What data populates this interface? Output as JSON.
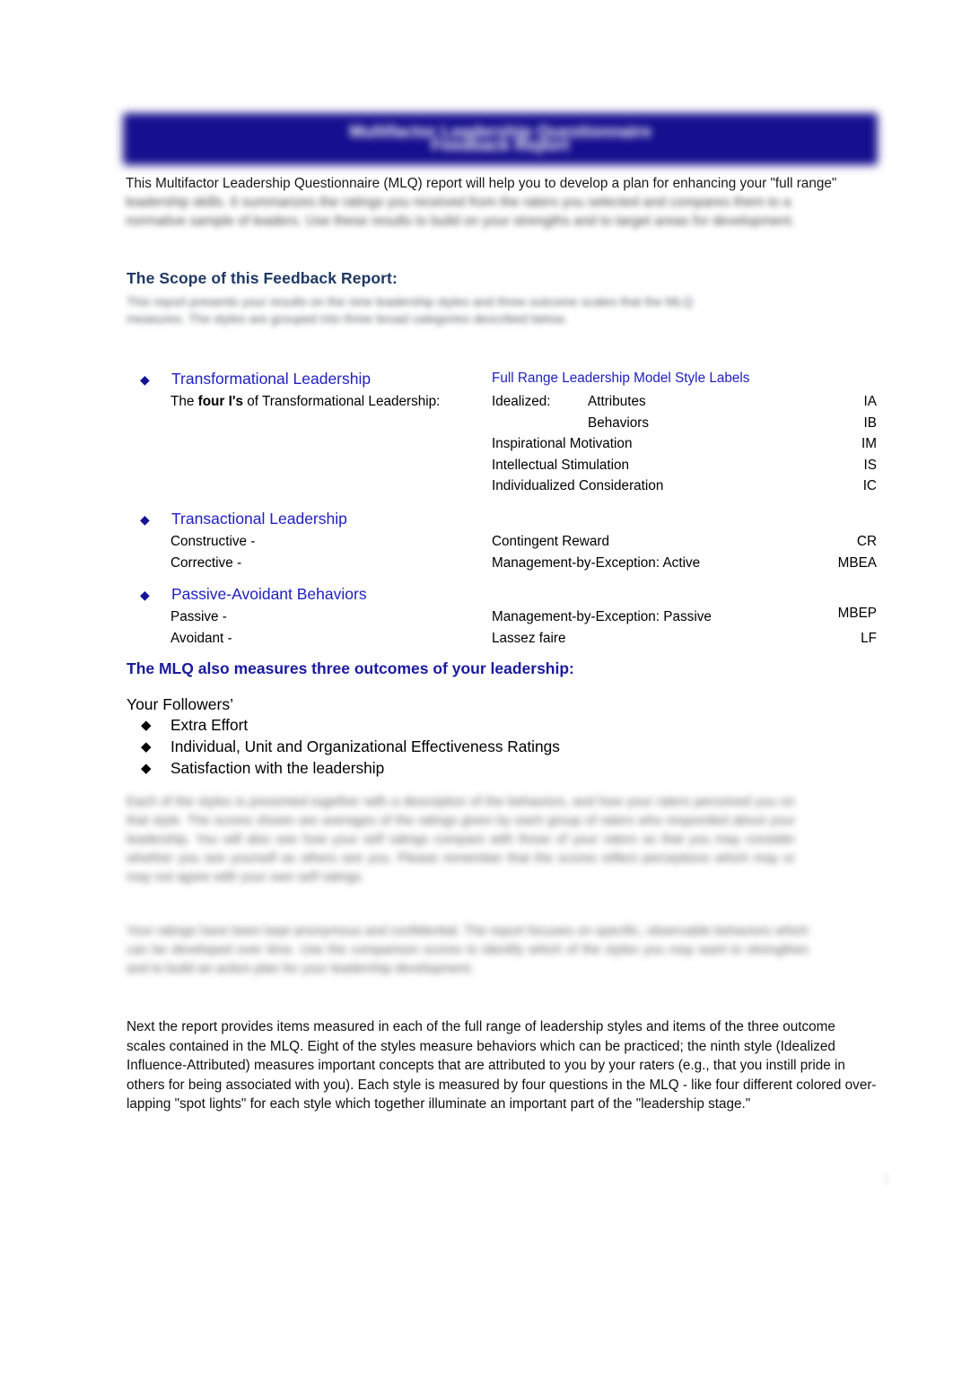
{
  "document": {
    "banner": {
      "title": "Multifactor Leadership Questionnaire\nFeedback Report",
      "color": "#160F8F"
    },
    "intro": {
      "line1": "This Multifactor Leadership Questionnaire (MLQ) report will help you to develop a plan for enhancing your \"full range\"",
      "blurred": "leadership skills. It summarizes the ratings you received from the raters you selected and compares them to a normative sample of leaders. Use these results to build on your strengths and to target areas for development."
    },
    "scope": {
      "heading": "The Scope of this Feedback Report:",
      "blurred": "This report presents your results on the nine leadership styles and three outcome scales that the MLQ measures. The styles are grouped into three broad categories described below."
    },
    "styles": [
      {
        "bullet": "◆",
        "title": "Transformational Leadership",
        "right_heading": "Full Range Leadership Model Style Labels",
        "rows": [
          {
            "left": "The four I's of Transformational Leadership:",
            "left_bold_part": "four I's",
            "mid": "Idealized:",
            "mid2": "Attributes",
            "abbr": "IA"
          },
          {
            "left": "",
            "mid": "",
            "mid2": "Behaviors",
            "abbr": "IB"
          },
          {
            "left": "",
            "mid": "Inspirational Motivation",
            "mid2": "",
            "abbr": "IM"
          },
          {
            "left": "",
            "mid": "Intellectual Stimulation",
            "mid2": "",
            "abbr": "IS"
          },
          {
            "left": "",
            "mid": "Individualized Consideration",
            "mid2": "",
            "abbr": "IC"
          }
        ]
      },
      {
        "bullet": "◆",
        "title": "Transactional Leadership",
        "right_heading": "",
        "rows": [
          {
            "left": "Constructive -",
            "mid": "Contingent Reward",
            "mid2": "",
            "abbr": "CR"
          },
          {
            "left": "Corrective -",
            "mid": "Management-by-Exception: Active",
            "mid2": "",
            "abbr": "MBEA"
          }
        ]
      },
      {
        "bullet": "◆",
        "title": "Passive-Avoidant Behaviors",
        "right_heading": "",
        "rows": [
          {
            "left": "Passive -",
            "mid": "Management-by-Exception: Passive",
            "mid2": "",
            "abbr": "MBEP"
          },
          {
            "left": "Avoidant -",
            "mid": "Lassez faire",
            "mid2": "",
            "abbr": "LF"
          }
        ]
      }
    ],
    "outcomes": {
      "heading": "The MLQ also measures three outcomes of your leadership:",
      "intro": "Your Followers’",
      "bullet": "◆",
      "items": [
        "Extra Effort",
        "Individual, Unit and Organizational Effectiveness Ratings",
        "Satisfaction with the leadership"
      ]
    },
    "body": {
      "blurred_1": "Each of the styles is presented together with a description of the behaviors, and how your raters perceived you on that style. The scores shown are averages of the ratings given by each group of raters who responded about your leadership. You will also see how your self ratings compare with those of your raters so that you may consider whether you see yourself as others see you. Please remember that the scores reflect perceptions which may or may not agree with your own self ratings.",
      "blurred_2": "Your ratings have been kept anonymous and confidential. The report focuses on specific, observable behaviors which can be developed over time. Use the comparison scores to identify which of the styles you may want to strengthen and to build an action plan for your leadership development.",
      "final": "Next the report provides items measured in each of the full range of leadership styles and items of the three outcome scales contained in the MLQ. Eight of the styles measure behaviors which can be practiced; the ninth style (Idealized Influence-Attributed) measures important concepts that are attributed to you by your raters (e.g., that you instill pride in others for being associated with you). Each style is measured by four questions in the MLQ - like four different colored over-lapping \"spot lights\" for each style which together illuminate an important part of the \"leadership stage.\""
    },
    "page_number": "1"
  }
}
